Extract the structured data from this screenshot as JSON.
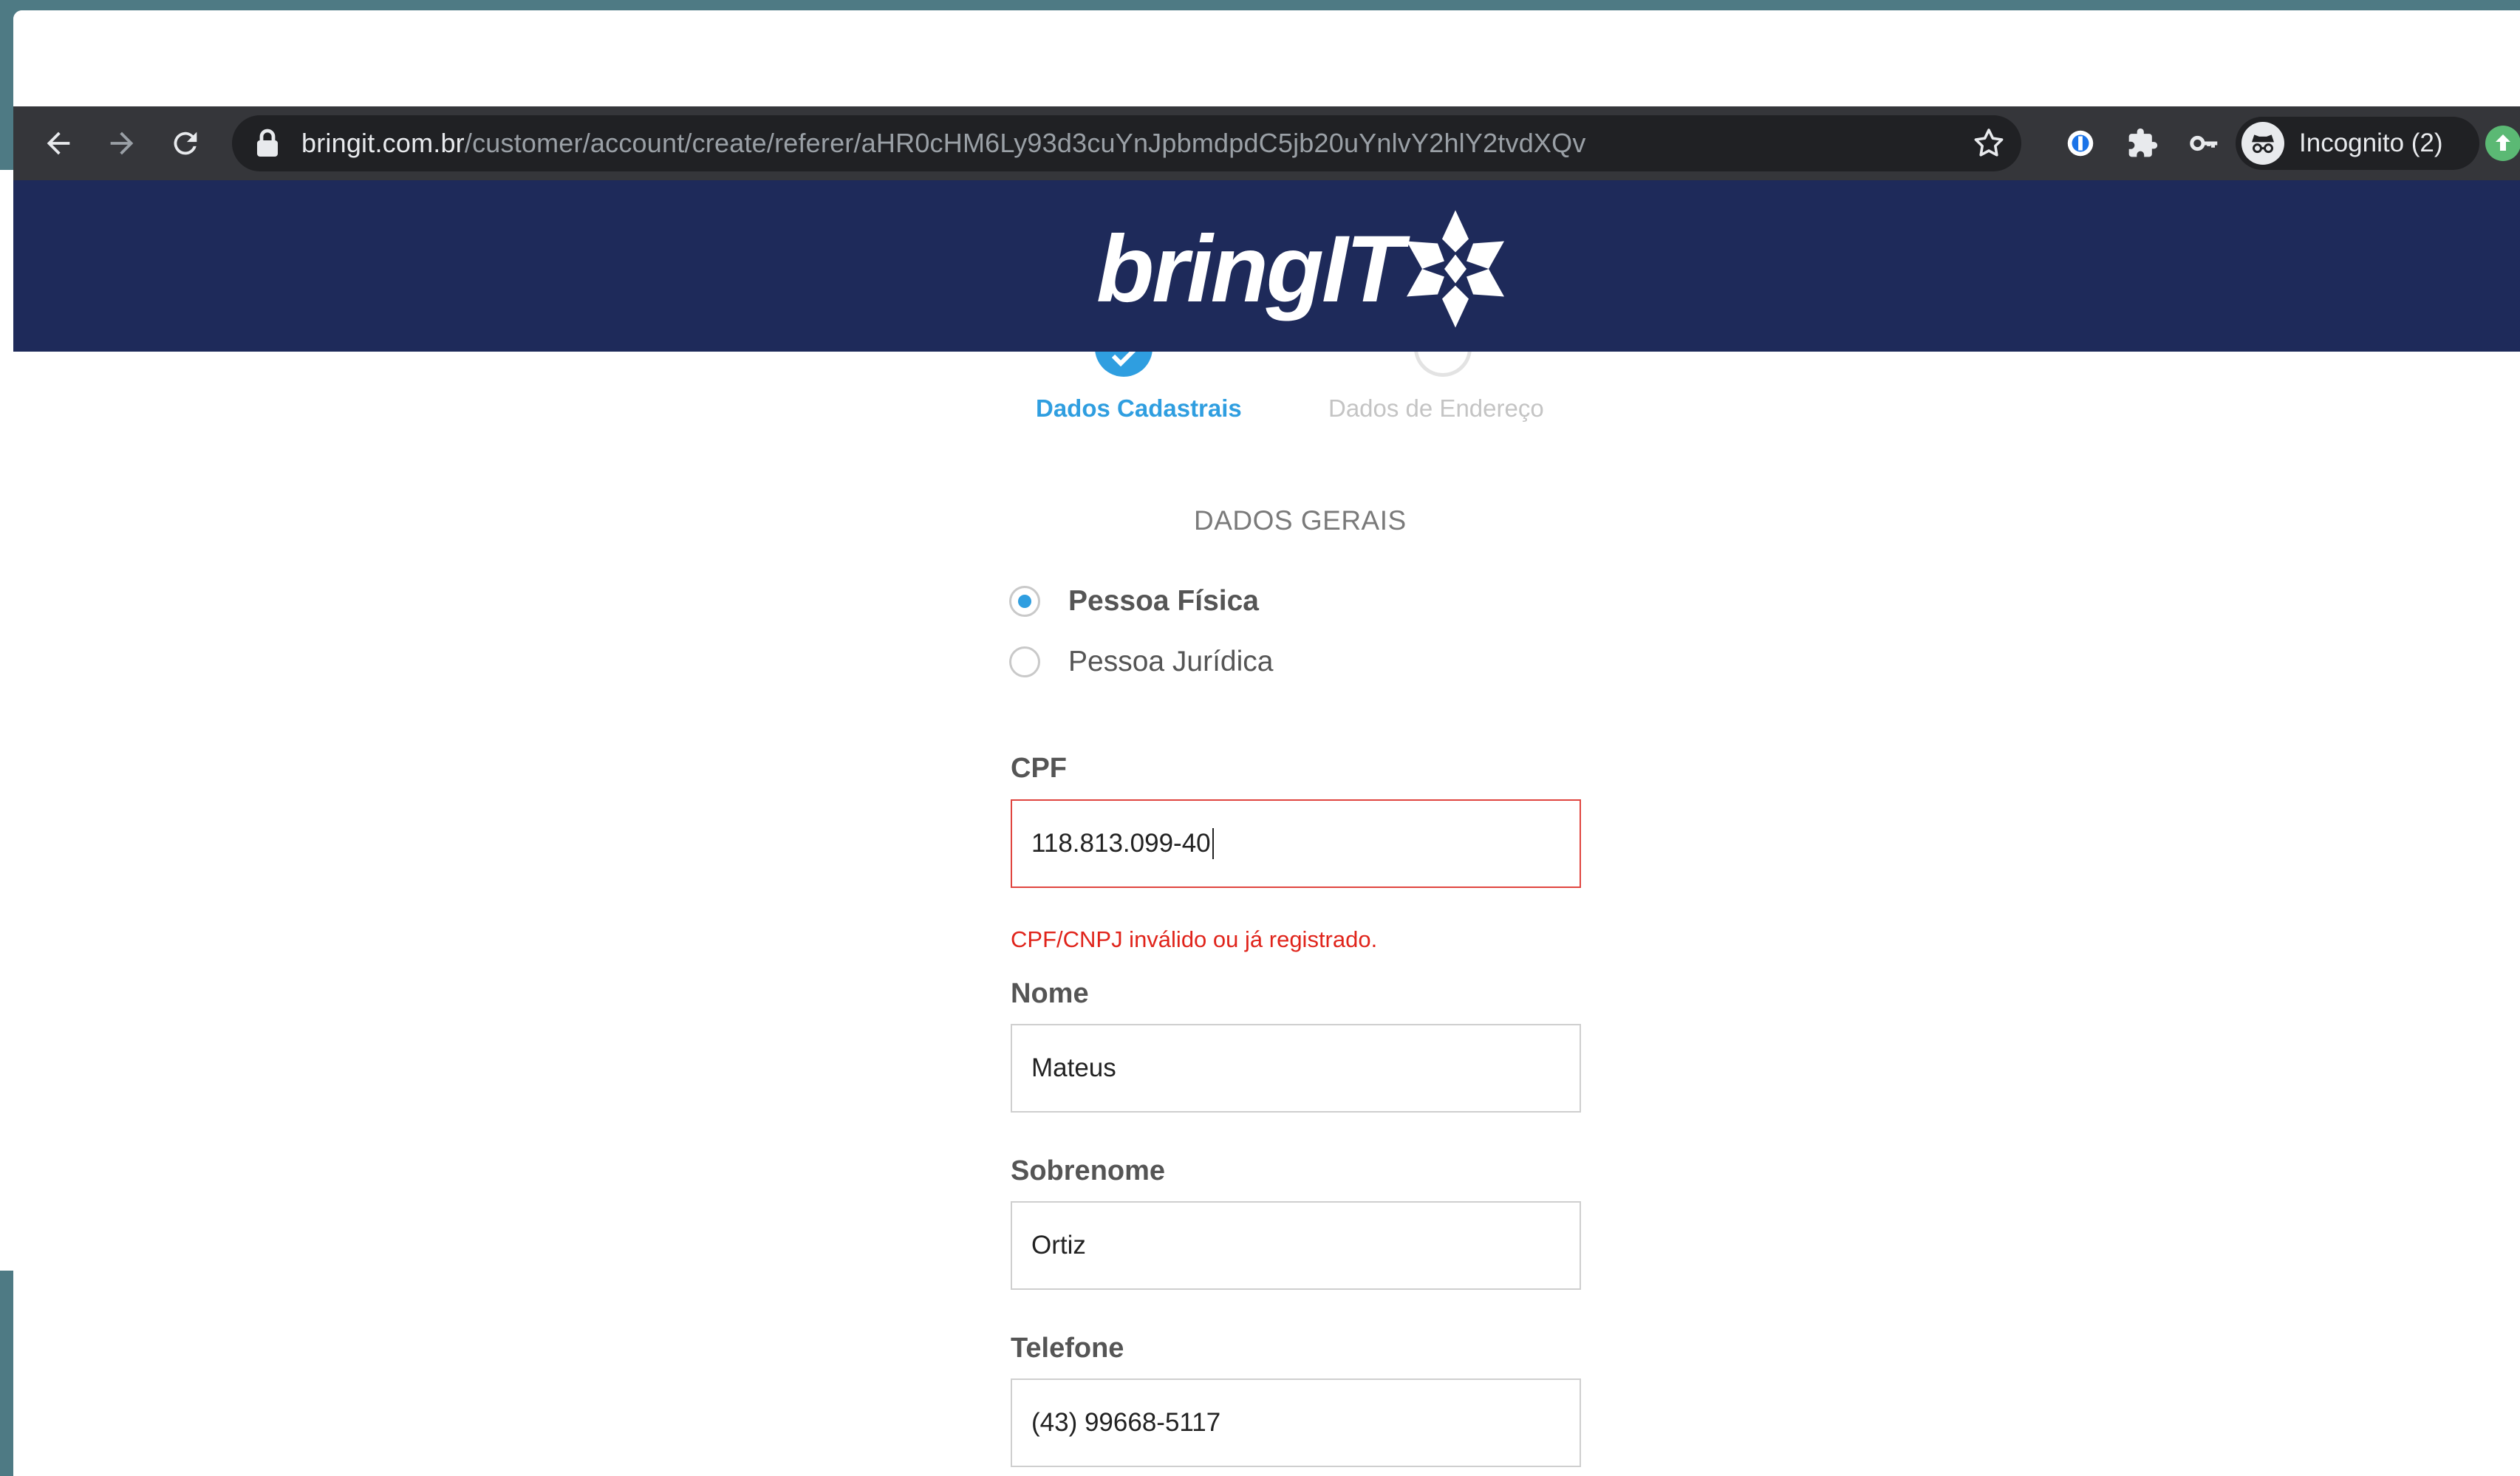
{
  "browser": {
    "url_host": "bringit.com.br",
    "url_path": "/customer/account/create/referer/aHR0cHM6Ly93d3cuYnJpbmdpdC5jb20uYnlvY2hlY2tvdXQv",
    "incognito_label": "Incognito (2)",
    "icons": [
      "back-arrow-icon",
      "forward-arrow-icon",
      "reload-icon",
      "lock-icon",
      "star-icon",
      "password-manager-icon",
      "puzzle-extension-icon",
      "key-icon",
      "incognito-icon",
      "update-icon"
    ]
  },
  "header": {
    "logo_text": "bringIT"
  },
  "stepper": {
    "steps": [
      {
        "label": "Dados Cadastrais",
        "state": "done"
      },
      {
        "label": "Dados de Endereço",
        "state": "pending"
      }
    ]
  },
  "form": {
    "section_title": "DADOS GERAIS",
    "person_type": {
      "options": [
        "Pessoa Física",
        "Pessoa Jurídica"
      ],
      "selected": "Pessoa Física"
    },
    "cpf": {
      "label": "CPF",
      "value": "118.813.099-40",
      "error": "CPF/CNPJ inválido ou já registrado."
    },
    "nome": {
      "label": "Nome",
      "value": "Mateus"
    },
    "sobrenome": {
      "label": "Sobrenome",
      "value": "Ortiz"
    },
    "telefone": {
      "label": "Telefone",
      "value": "(43) 99668-5117"
    }
  },
  "colors": {
    "header_bg": "#1e2a5a",
    "accent": "#2f9ee0",
    "error": "#e0241b",
    "toolbar": "#35363a"
  }
}
